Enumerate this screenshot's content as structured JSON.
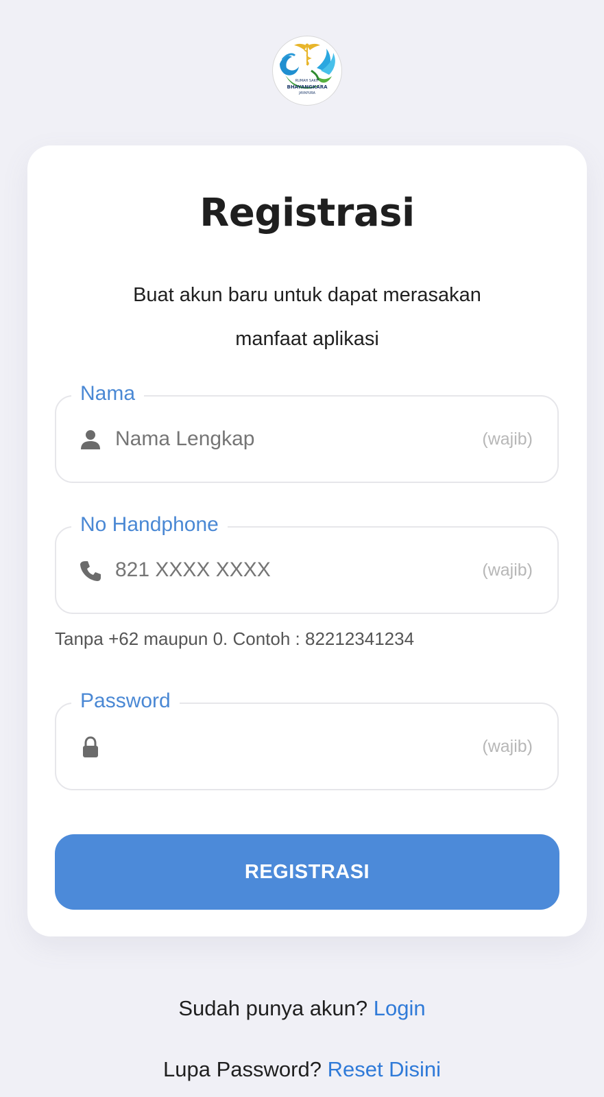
{
  "logo": {
    "line1": "RUMAH SAKIT",
    "line2": "BHAYANGKARA",
    "line3": "JAYAPURA"
  },
  "form": {
    "title": "Registrasi",
    "subtitle": "Buat akun baru untuk dapat merasakan manfaat aplikasi",
    "fields": [
      {
        "label": "Nama",
        "placeholder": "Nama Lengkap",
        "value": "",
        "required_hint": "(wajib)",
        "icon": "person-icon"
      },
      {
        "label": "No Handphone",
        "placeholder": "821 XXXX XXXX",
        "value": "",
        "required_hint": "(wajib)",
        "icon": "phone-icon"
      },
      {
        "label": "Password",
        "placeholder": "",
        "value": "",
        "required_hint": "(wajib)",
        "icon": "lock-icon"
      }
    ],
    "phone_helper": "Tanpa +62 maupun 0. Contoh : 82212341234",
    "submit_label": "REGISTRASI"
  },
  "footer": {
    "login_prompt": "Sudah punya akun?",
    "login_link": "Login",
    "reset_prompt": "Lupa Password?",
    "reset_link": "Reset Disini"
  },
  "colors": {
    "accent": "#4c8ad9",
    "label": "#4a88d4",
    "link": "#2f7ad8",
    "background": "#f0f0f6"
  }
}
